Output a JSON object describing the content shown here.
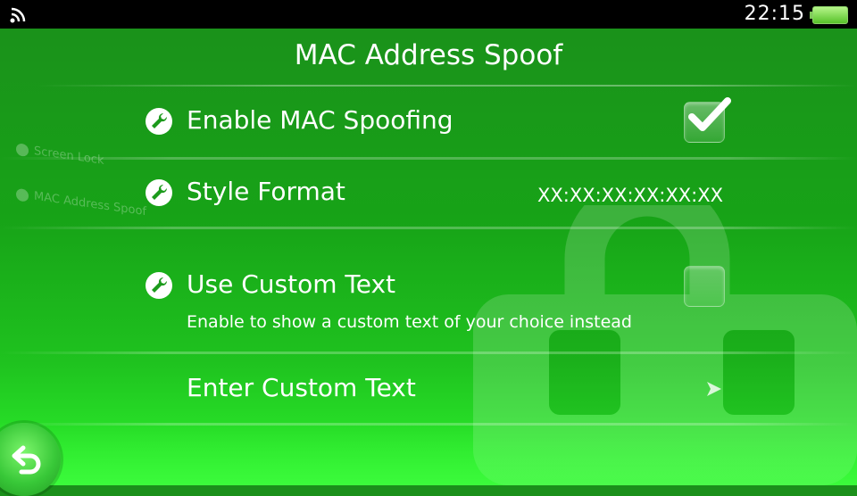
{
  "status_bar": {
    "wifi_icon": "wifi-icon",
    "time": "22:15",
    "battery_icon": "battery-icon"
  },
  "page": {
    "title": "MAC Address Spoof"
  },
  "background_menu": {
    "items": [
      "Screen Lock",
      "MAC Address Spoof"
    ]
  },
  "settings": [
    {
      "label": "Enable MAC Spoofing",
      "icon": "wrench-icon",
      "control": "checkbox",
      "checked": true
    },
    {
      "label": "Style Format",
      "icon": "wrench-icon",
      "control": "value",
      "value": "XX:XX:XX:XX:XX:XX"
    },
    {
      "label": "Use Custom Text",
      "icon": "wrench-icon",
      "control": "checkbox",
      "checked": false,
      "description": "Enable to show a custom text of your choice instead"
    },
    {
      "label": "Enter Custom Text",
      "control": "arrow",
      "arrow_icon": "chevron-right-icon"
    }
  ],
  "back_button": {
    "icon": "back-arrow-icon"
  },
  "colors": {
    "background_top": "#1b8f1b",
    "background_bottom": "#2ef52e",
    "status_bar": "#000000",
    "text": "#ffffff"
  }
}
